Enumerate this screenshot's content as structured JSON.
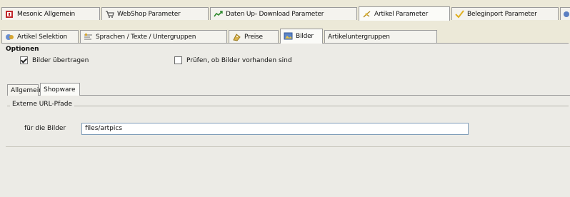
{
  "main_tabs": [
    {
      "label": "Mesonic Allgemein",
      "icon": "mesonic-icon"
    },
    {
      "label": "WebShop Parameter",
      "icon": "cart-icon"
    },
    {
      "label": "Daten Up- Download Parameter",
      "icon": "transfer-icon"
    },
    {
      "label": "Artikel Parameter",
      "icon": "article-icon"
    },
    {
      "label": "Beleginport Parameter",
      "icon": "check-icon"
    }
  ],
  "sub_tabs": [
    {
      "label": "Artikel Selektion",
      "icon": "selection-icon"
    },
    {
      "label": "Sprachen / Texte / Untergruppen",
      "icon": "text-icon"
    },
    {
      "label": "Preise",
      "icon": "price-icon"
    },
    {
      "label": "Bilder",
      "icon": "image-icon"
    },
    {
      "label": "Artikeluntergruppen"
    }
  ],
  "options": {
    "title": "Optionen",
    "transfer_images": {
      "label": "Bilder übertragen",
      "checked": true
    },
    "check_images": {
      "label": "Prüfen, ob Bilder vorhanden sind",
      "checked": false
    }
  },
  "inner_tabs": [
    "Allgemein",
    "Shopware"
  ],
  "url_group": {
    "title": "Externe URL-Pfade",
    "field_label": "für die  Bilder",
    "field_value": "files/artpics"
  }
}
